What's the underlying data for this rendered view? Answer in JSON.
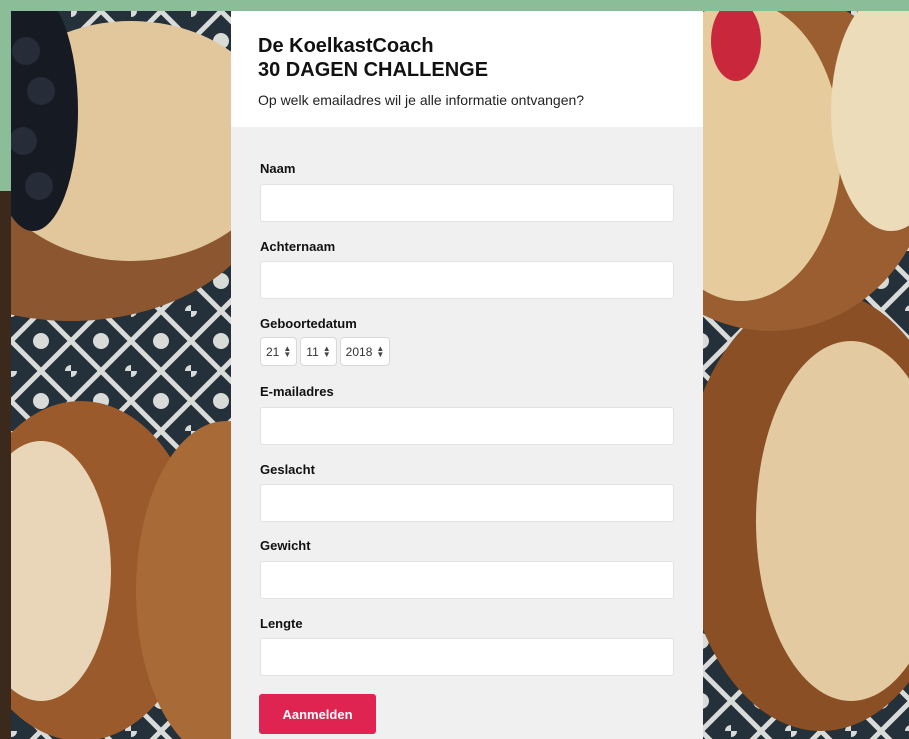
{
  "form": {
    "title_line1": "De KoelkastCoach",
    "title_line2": "30 DAGEN CHALLENGE",
    "subtitle": "Op welk emailadres wil je alle informatie ontvangen?",
    "fields": {
      "naam": {
        "label": "Naam",
        "value": "",
        "placeholder": ""
      },
      "achternaam": {
        "label": "Achternaam",
        "value": "",
        "placeholder": ""
      },
      "geboortedatum": {
        "label": "Geboortedatum",
        "day": "21",
        "month": "11",
        "year": "2018"
      },
      "email": {
        "label": "E-mailadres",
        "value": "",
        "placeholder": ""
      },
      "geslacht": {
        "label": "Geslacht",
        "value": "",
        "placeholder": ""
      },
      "gewicht": {
        "label": "Gewicht",
        "value": "",
        "placeholder": ""
      },
      "lengte": {
        "label": "Lengte",
        "value": "",
        "placeholder": ""
      }
    },
    "submit_label": "Aanmelden"
  },
  "colors": {
    "accent_band": "#8bbd99",
    "submit_button": "#e02452",
    "form_background": "#f0f0f0",
    "header_background": "#ffffff"
  },
  "icons": {
    "select_stepper": "up-down-arrows-icon"
  }
}
